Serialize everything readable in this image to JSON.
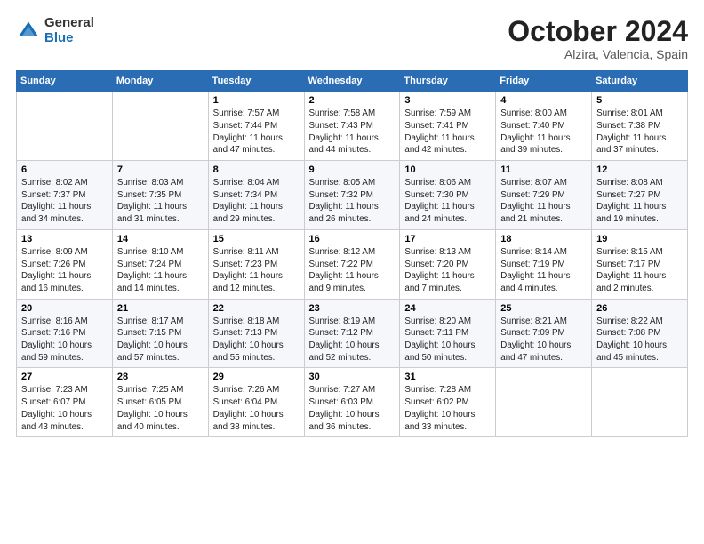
{
  "header": {
    "logo_general": "General",
    "logo_blue": "Blue",
    "title": "October 2024",
    "subtitle": "Alzira, Valencia, Spain"
  },
  "days_of_week": [
    "Sunday",
    "Monday",
    "Tuesday",
    "Wednesday",
    "Thursday",
    "Friday",
    "Saturday"
  ],
  "weeks": [
    [
      {
        "day": "",
        "info": ""
      },
      {
        "day": "",
        "info": ""
      },
      {
        "day": "1",
        "info": "Sunrise: 7:57 AM\nSunset: 7:44 PM\nDaylight: 11 hours and 47 minutes."
      },
      {
        "day": "2",
        "info": "Sunrise: 7:58 AM\nSunset: 7:43 PM\nDaylight: 11 hours and 44 minutes."
      },
      {
        "day": "3",
        "info": "Sunrise: 7:59 AM\nSunset: 7:41 PM\nDaylight: 11 hours and 42 minutes."
      },
      {
        "day": "4",
        "info": "Sunrise: 8:00 AM\nSunset: 7:40 PM\nDaylight: 11 hours and 39 minutes."
      },
      {
        "day": "5",
        "info": "Sunrise: 8:01 AM\nSunset: 7:38 PM\nDaylight: 11 hours and 37 minutes."
      }
    ],
    [
      {
        "day": "6",
        "info": "Sunrise: 8:02 AM\nSunset: 7:37 PM\nDaylight: 11 hours and 34 minutes."
      },
      {
        "day": "7",
        "info": "Sunrise: 8:03 AM\nSunset: 7:35 PM\nDaylight: 11 hours and 31 minutes."
      },
      {
        "day": "8",
        "info": "Sunrise: 8:04 AM\nSunset: 7:34 PM\nDaylight: 11 hours and 29 minutes."
      },
      {
        "day": "9",
        "info": "Sunrise: 8:05 AM\nSunset: 7:32 PM\nDaylight: 11 hours and 26 minutes."
      },
      {
        "day": "10",
        "info": "Sunrise: 8:06 AM\nSunset: 7:30 PM\nDaylight: 11 hours and 24 minutes."
      },
      {
        "day": "11",
        "info": "Sunrise: 8:07 AM\nSunset: 7:29 PM\nDaylight: 11 hours and 21 minutes."
      },
      {
        "day": "12",
        "info": "Sunrise: 8:08 AM\nSunset: 7:27 PM\nDaylight: 11 hours and 19 minutes."
      }
    ],
    [
      {
        "day": "13",
        "info": "Sunrise: 8:09 AM\nSunset: 7:26 PM\nDaylight: 11 hours and 16 minutes."
      },
      {
        "day": "14",
        "info": "Sunrise: 8:10 AM\nSunset: 7:24 PM\nDaylight: 11 hours and 14 minutes."
      },
      {
        "day": "15",
        "info": "Sunrise: 8:11 AM\nSunset: 7:23 PM\nDaylight: 11 hours and 12 minutes."
      },
      {
        "day": "16",
        "info": "Sunrise: 8:12 AM\nSunset: 7:22 PM\nDaylight: 11 hours and 9 minutes."
      },
      {
        "day": "17",
        "info": "Sunrise: 8:13 AM\nSunset: 7:20 PM\nDaylight: 11 hours and 7 minutes."
      },
      {
        "day": "18",
        "info": "Sunrise: 8:14 AM\nSunset: 7:19 PM\nDaylight: 11 hours and 4 minutes."
      },
      {
        "day": "19",
        "info": "Sunrise: 8:15 AM\nSunset: 7:17 PM\nDaylight: 11 hours and 2 minutes."
      }
    ],
    [
      {
        "day": "20",
        "info": "Sunrise: 8:16 AM\nSunset: 7:16 PM\nDaylight: 10 hours and 59 minutes."
      },
      {
        "day": "21",
        "info": "Sunrise: 8:17 AM\nSunset: 7:15 PM\nDaylight: 10 hours and 57 minutes."
      },
      {
        "day": "22",
        "info": "Sunrise: 8:18 AM\nSunset: 7:13 PM\nDaylight: 10 hours and 55 minutes."
      },
      {
        "day": "23",
        "info": "Sunrise: 8:19 AM\nSunset: 7:12 PM\nDaylight: 10 hours and 52 minutes."
      },
      {
        "day": "24",
        "info": "Sunrise: 8:20 AM\nSunset: 7:11 PM\nDaylight: 10 hours and 50 minutes."
      },
      {
        "day": "25",
        "info": "Sunrise: 8:21 AM\nSunset: 7:09 PM\nDaylight: 10 hours and 47 minutes."
      },
      {
        "day": "26",
        "info": "Sunrise: 8:22 AM\nSunset: 7:08 PM\nDaylight: 10 hours and 45 minutes."
      }
    ],
    [
      {
        "day": "27",
        "info": "Sunrise: 7:23 AM\nSunset: 6:07 PM\nDaylight: 10 hours and 43 minutes."
      },
      {
        "day": "28",
        "info": "Sunrise: 7:25 AM\nSunset: 6:05 PM\nDaylight: 10 hours and 40 minutes."
      },
      {
        "day": "29",
        "info": "Sunrise: 7:26 AM\nSunset: 6:04 PM\nDaylight: 10 hours and 38 minutes."
      },
      {
        "day": "30",
        "info": "Sunrise: 7:27 AM\nSunset: 6:03 PM\nDaylight: 10 hours and 36 minutes."
      },
      {
        "day": "31",
        "info": "Sunrise: 7:28 AM\nSunset: 6:02 PM\nDaylight: 10 hours and 33 minutes."
      },
      {
        "day": "",
        "info": ""
      },
      {
        "day": "",
        "info": ""
      }
    ]
  ]
}
